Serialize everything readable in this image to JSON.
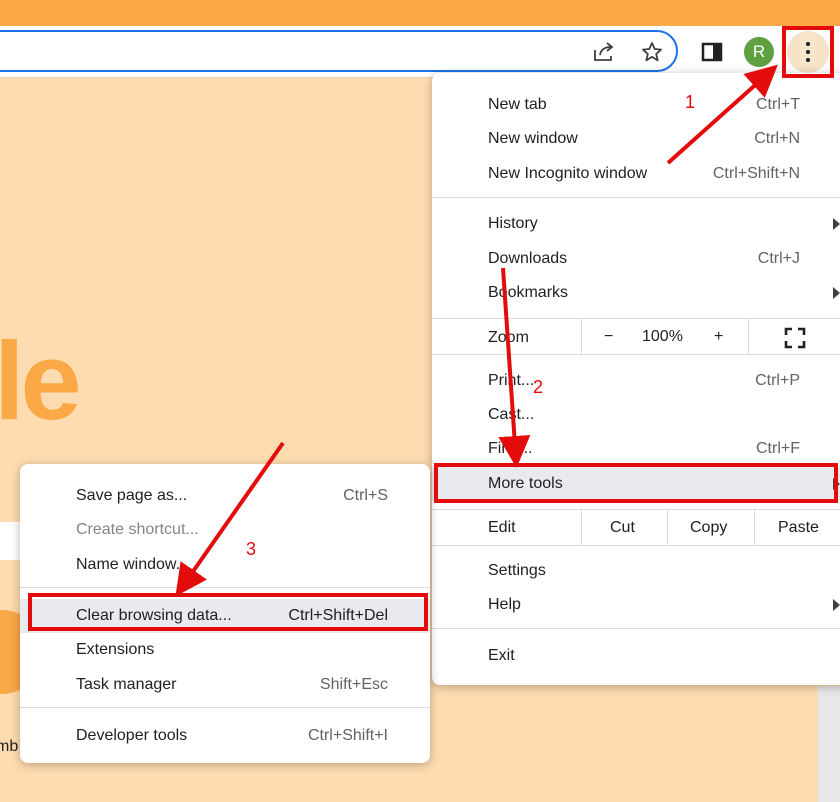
{
  "toolbar": {
    "avatar_letter": "R",
    "icons": [
      "share-icon",
      "star-icon",
      "side-panel-icon",
      "more-vert-icon"
    ]
  },
  "page": {
    "big_text": "le",
    "cut_text": "mb"
  },
  "main_menu": {
    "new_tab": {
      "label": "New tab",
      "shortcut": "Ctrl+T"
    },
    "new_window": {
      "label": "New window",
      "shortcut": "Ctrl+N"
    },
    "incognito": {
      "label": "New Incognito window",
      "shortcut": "Ctrl+Shift+N"
    },
    "history": {
      "label": "History"
    },
    "downloads": {
      "label": "Downloads",
      "shortcut": "Ctrl+J"
    },
    "bookmarks": {
      "label": "Bookmarks"
    },
    "zoom": {
      "label": "Zoom",
      "minus": "−",
      "value": "100%",
      "plus": "+"
    },
    "print": {
      "label": "Print...",
      "shortcut": "Ctrl+P"
    },
    "cast": {
      "label": "Cast..."
    },
    "find": {
      "label": "Find...",
      "shortcut": "Ctrl+F"
    },
    "more_tools": {
      "label": "More tools"
    },
    "edit": {
      "label": "Edit",
      "cut": "Cut",
      "copy": "Copy",
      "paste": "Paste"
    },
    "settings": {
      "label": "Settings"
    },
    "help": {
      "label": "Help"
    },
    "exit": {
      "label": "Exit"
    }
  },
  "sub_menu": {
    "save_page": {
      "label": "Save page as...",
      "shortcut": "Ctrl+S"
    },
    "create_shortcut": {
      "label": "Create shortcut..."
    },
    "name_window": {
      "label": "Name window..."
    },
    "clear_browsing": {
      "label": "Clear browsing data...",
      "shortcut": "Ctrl+Shift+Del"
    },
    "extensions": {
      "label": "Extensions"
    },
    "task_manager": {
      "label": "Task manager",
      "shortcut": "Shift+Esc"
    },
    "developer_tools": {
      "label": "Developer tools",
      "shortcut": "Ctrl+Shift+I"
    }
  },
  "annotations": {
    "step1": "1",
    "step2": "2",
    "step3": "3",
    "color": "#e30b0b"
  }
}
